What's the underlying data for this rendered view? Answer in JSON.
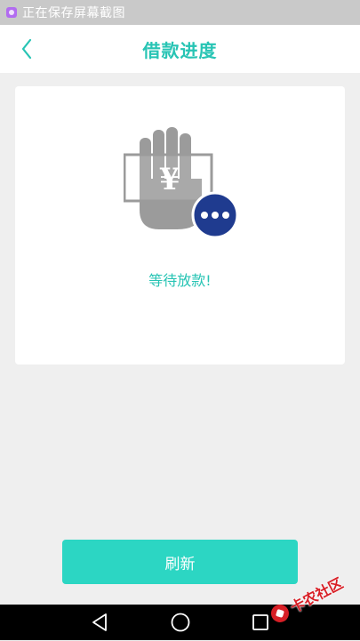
{
  "status_bar": {
    "notification_text": "正在保存屏幕截图",
    "icon": "screenshot-icon"
  },
  "header": {
    "title": "借款进度",
    "back_icon": "chevron-left-icon"
  },
  "card": {
    "icon": "hand-money-waiting-icon",
    "currency_symbol": "¥",
    "message": "等待放款!"
  },
  "actions": {
    "refresh_label": "刷新"
  },
  "nav_bar": {
    "icons": [
      "back-triangle-icon",
      "home-circle-icon",
      "recent-square-icon"
    ]
  },
  "watermark": {
    "text": "卡农社区"
  },
  "colors": {
    "accent": "#27c4b4",
    "button": "#2cd6c3",
    "badge": "#1f3b8f",
    "watermark": "#d81f26"
  }
}
